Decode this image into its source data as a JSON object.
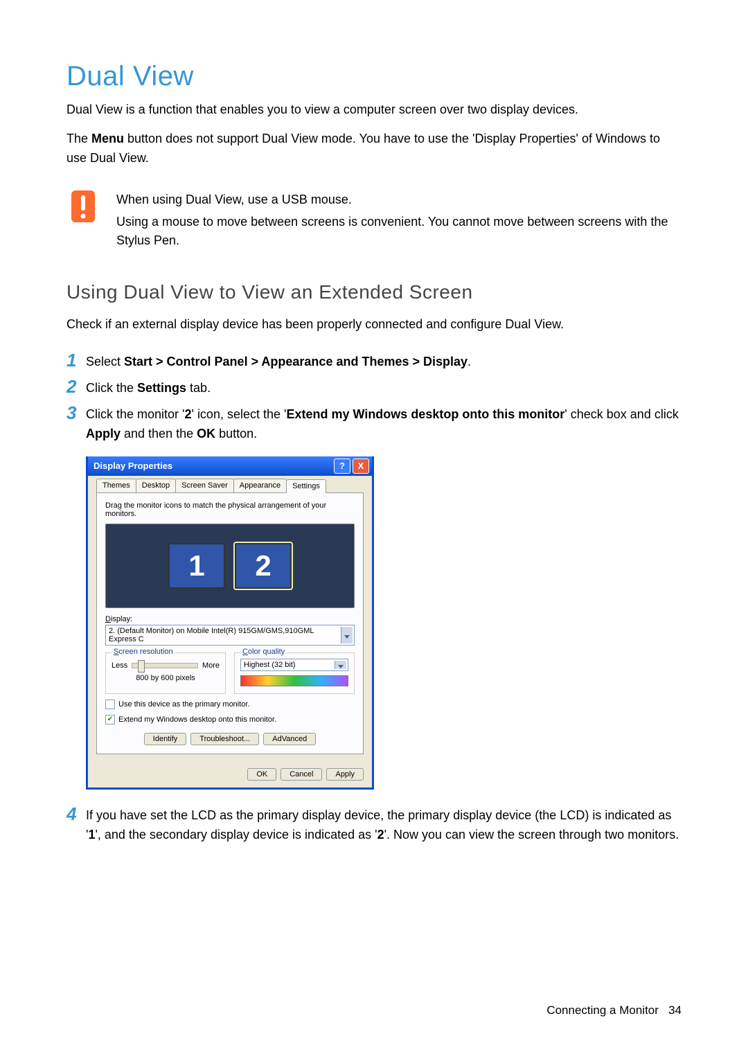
{
  "title": "Dual View",
  "intro": [
    "Dual View is a function that enables you to view a computer screen over two display devices.",
    "The Menu button does not support Dual View mode. You have to use the 'Display Properties' of Windows to use Dual View."
  ],
  "intro_bold": "Menu",
  "callout": {
    "lines": [
      "When using Dual View, use a USB mouse.",
      "Using a mouse to move between screens is convenient. You cannot move between screens with the Stylus Pen."
    ]
  },
  "section_heading": "Using Dual View to View an Extended Screen",
  "section_lead": "Check if an external display device has been properly connected and configure Dual View.",
  "steps": [
    {
      "num": "1",
      "pre": "Select ",
      "bold": "Start > Control Panel > Appearance and Themes > Display",
      "post": "."
    },
    {
      "num": "2",
      "pre": "Click the ",
      "bold": "Settings",
      "post": " tab."
    },
    {
      "num": "3",
      "pre": "Click the monitor '",
      "bold": "2",
      "mid": "' icon, select the '",
      "bold2": "Extend my Windows desktop onto this monitor",
      "mid2": "' check box and click ",
      "bold3": "Apply",
      "mid3": " and then the ",
      "bold4": "OK",
      "post": " button."
    },
    {
      "num": "4",
      "pre": "If you have set the LCD as the primary display device, the primary display device (the LCD) is indicated as '",
      "bold": "1",
      "mid": "', and the secondary display device is indicated as '",
      "bold2": "2",
      "post": "'. Now you can view the screen through two monitors."
    }
  ],
  "dialog": {
    "title": "Display Properties",
    "tabs": [
      "Themes",
      "Desktop",
      "Screen Saver",
      "Appearance",
      "Settings"
    ],
    "active_tab": 4,
    "drag_hint": "Drag the monitor icons to match the physical arrangement of your monitors.",
    "mon1": "1",
    "mon2": "2",
    "display_label": "Display:",
    "display_underline": "D",
    "display_value": "2. (Default Monitor) on Mobile Intel(R) 915GM/GMS,910GML Express C",
    "res_group_label": "Screen resolution",
    "res_group_ul": "S",
    "res_less": "Less",
    "res_more": "More",
    "res_value": "800 by 600 pixels",
    "cq_group_label": "Color quality",
    "cq_group_ul": "C",
    "cq_value": "Highest (32 bit)",
    "chk_primary_label": "Use this device as the primary monitor.",
    "chk_primary_ul": "U",
    "chk_extend_label": "Extend my Windows desktop onto this monitor.",
    "chk_extend_ul": "E",
    "chk_extend_checked": true,
    "btn_identify": "Identify",
    "btn_identify_ul": "I",
    "btn_troubleshoot": "Troubleshoot...",
    "btn_troubleshoot_ul": "T",
    "btn_advanced": "Advanced",
    "btn_advanced_ul": "V",
    "btn_ok": "OK",
    "btn_cancel": "Cancel",
    "btn_apply": "Apply",
    "btn_apply_ul": "A"
  },
  "footer": {
    "section": "Connecting a Monitor",
    "page": "34"
  }
}
